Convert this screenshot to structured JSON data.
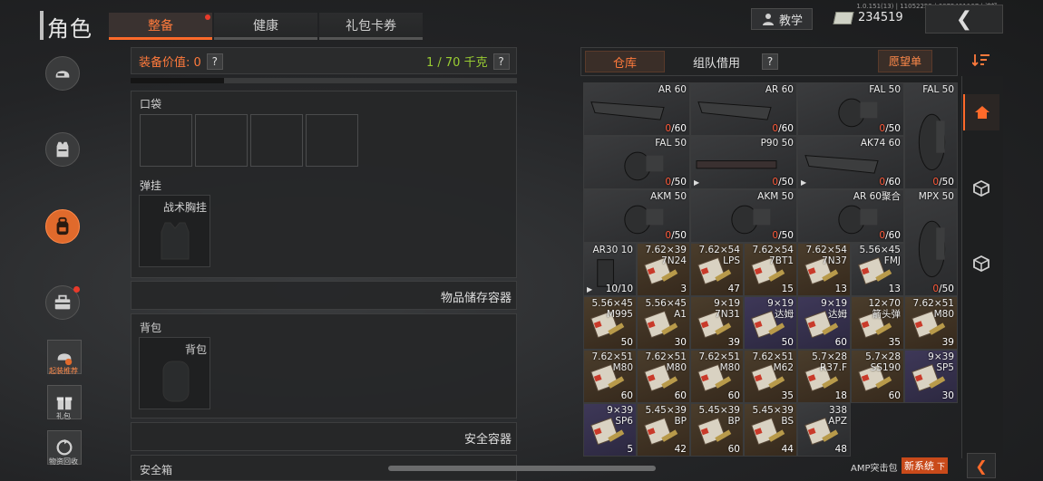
{
  "header": {
    "title": "角色",
    "tabs": [
      {
        "label": "整备",
        "active": true,
        "has_dot": true
      },
      {
        "label": "健康",
        "active": false
      },
      {
        "label": "礼包卡券",
        "active": false
      }
    ],
    "version": "1.0.151(13) | 11052252 | 6075401167 | 流畅",
    "teach_label": "教学",
    "money": "234519"
  },
  "nav": {
    "items": [
      {
        "name": "helmet-icon"
      },
      {
        "name": "vest-icon"
      },
      {
        "name": "backpack-icon",
        "active": true
      },
      {
        "name": "toolbox-icon",
        "has_dot": true
      }
    ],
    "quick": [
      {
        "label": "起装推荐",
        "orange": true
      },
      {
        "label": "礼包"
      },
      {
        "label": "物资回收"
      }
    ]
  },
  "equipment": {
    "value_label": "装备价值: 0",
    "weight_label": "1 / 70 千克",
    "question": "?",
    "pocket_label": "口袋",
    "rig_label": "弹挂",
    "rig_item": "战术胸挂",
    "storage_title": "物品储存容器",
    "backpack_label": "背包",
    "backpack_item": "背包",
    "safe_container_title": "安全容器",
    "safe_box_label": "安全箱"
  },
  "warehouse": {
    "tabs": [
      {
        "label": "仓库",
        "active": true
      },
      {
        "label": "组队借用",
        "active": false
      }
    ],
    "question": "?",
    "wish_label": "愿望单",
    "items": [
      {
        "name": "AR 60",
        "qty_zero": "0",
        "qty": "/60",
        "kind": "mag",
        "color": "gray"
      },
      {
        "name": "AR 60",
        "qty_zero": "0",
        "qty": "/60",
        "kind": "mag",
        "color": "gray"
      },
      {
        "name": "FAL 50",
        "qty_zero": "0",
        "qty": "/50",
        "kind": "drum",
        "color": "gray"
      },
      {
        "name": "FAL 50",
        "qty_zero": "0",
        "qty": "/50",
        "kind": "drum",
        "color": "gray"
      },
      {
        "name": "FAL 50",
        "qty_zero": "0",
        "qty": "/50",
        "kind": "drum",
        "color": "gray"
      },
      {
        "name": "P90 50",
        "qty_zero": "0",
        "qty": "/50",
        "kind": "p90",
        "color": "gray",
        "pinned": true
      },
      {
        "name": "AK74 60",
        "qty_zero": "0",
        "qty": "/60",
        "kind": "mag",
        "color": "gray",
        "pinned": true
      },
      {
        "name": "AKM 50",
        "qty_zero": "0",
        "qty": "/50",
        "kind": "drum",
        "color": "gray"
      },
      {
        "name": "AKM 50",
        "qty_zero": "0",
        "qty": "/50",
        "kind": "drum",
        "color": "gray"
      },
      {
        "name": "AR 60聚合",
        "qty_zero": "0",
        "qty": "/60",
        "kind": "drum",
        "color": "gray"
      },
      {
        "name": "MPX 50",
        "qty_zero": "0",
        "qty": "/50",
        "kind": "drum",
        "color": "gray"
      },
      {
        "name": "AR30 10",
        "qty": "10/10",
        "kind": "smallmag",
        "color": "gray",
        "pinned": true
      },
      {
        "name": "7.62×39\n7N24",
        "qty": "3",
        "kind": "ammo",
        "color": "brown"
      },
      {
        "name": "7.62×54\nLPS",
        "qty": "47",
        "kind": "ammo",
        "color": "brown"
      },
      {
        "name": "7.62×54\n7BT1",
        "qty": "15",
        "kind": "ammo",
        "color": "brown"
      },
      {
        "name": "7.62×54\n7N37",
        "qty": "13",
        "kind": "ammo",
        "color": "brown"
      },
      {
        "name": "5.56×45\nFMJ",
        "qty": "13",
        "kind": "ammo",
        "color": "gray"
      },
      {
        "name": "5.56×45\nM995",
        "qty": "50",
        "kind": "ammo",
        "color": "brown"
      },
      {
        "name": "5.56×45\nA1",
        "qty": "30",
        "kind": "ammo",
        "color": "brown"
      },
      {
        "name": "9×19\n7N31",
        "qty": "39",
        "kind": "ammo",
        "color": "brown"
      },
      {
        "name": "9×19\n达姆",
        "qty": "50",
        "kind": "ammo",
        "color": "purple"
      },
      {
        "name": "9×19\n达姆",
        "qty": "60",
        "kind": "ammo",
        "color": "purple"
      },
      {
        "name": "12×70\n箭头弹",
        "qty": "35",
        "kind": "ammo",
        "color": "brown"
      },
      {
        "name": "7.62×51\nM80",
        "qty": "39",
        "kind": "ammo",
        "color": "brown"
      },
      {
        "name": "7.62×51\nM80",
        "qty": "60",
        "kind": "ammo",
        "color": "brown"
      },
      {
        "name": "7.62×51\nM80",
        "qty": "60",
        "kind": "ammo",
        "color": "brown"
      },
      {
        "name": "7.62×51\nM80",
        "qty": "60",
        "kind": "ammo",
        "color": "brown"
      },
      {
        "name": "7.62×51\nM62",
        "qty": "35",
        "kind": "ammo",
        "color": "brown"
      },
      {
        "name": "5.7×28\nR37.F",
        "qty": "18",
        "kind": "ammo",
        "color": "brown"
      },
      {
        "name": "5.7×28\nSS190",
        "qty": "60",
        "kind": "ammo",
        "color": "brown"
      },
      {
        "name": "9×39\nSP5",
        "qty": "30",
        "kind": "ammo",
        "color": "purple"
      },
      {
        "name": "9×39\nSP6",
        "qty": "5",
        "kind": "ammo",
        "color": "purple"
      },
      {
        "name": "5.45×39\nBP",
        "qty": "42",
        "kind": "ammo",
        "color": "brown"
      },
      {
        "name": "5.45×39\nBP",
        "qty": "60",
        "kind": "ammo",
        "color": "brown"
      },
      {
        "name": "5.45×39\nBS",
        "qty": "44",
        "kind": "ammo",
        "color": "brown"
      },
      {
        "name": "338\nAPZ",
        "qty": "48",
        "kind": "ammo",
        "color": "gray"
      }
    ],
    "bottom_note": "AMP突击包",
    "new_system": "新系统",
    "new_system_suffix": "下"
  },
  "colors": {
    "accent": "#ff6a2a",
    "brown_cell": "#4a3d2c",
    "purple_cell": "#3e3858",
    "gray_cell": "#3b3c3e"
  }
}
